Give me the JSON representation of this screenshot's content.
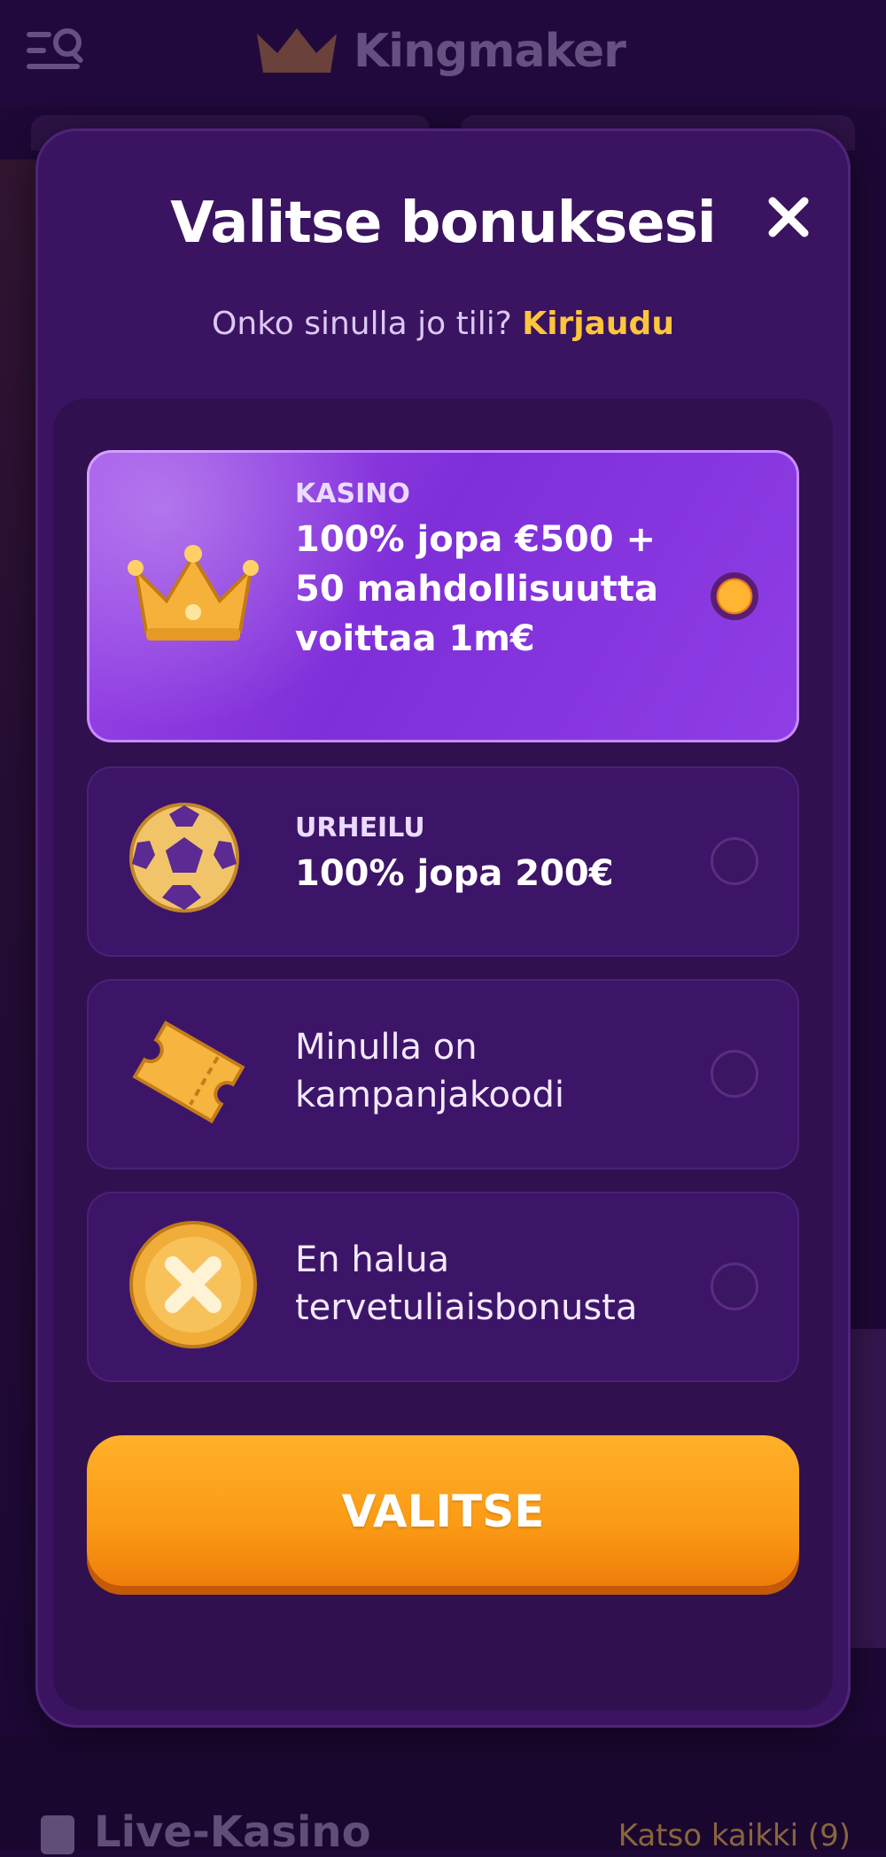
{
  "background": {
    "logo_text": "Kingmaker",
    "section_title": "Live-Kasino",
    "see_all": "Katso kaikki (9)"
  },
  "modal": {
    "title": "Valitse bonuksesi",
    "login_prompt": "Onko sinulla jo tili?",
    "login_link": "Kirjaudu",
    "options": [
      {
        "category": "KASINO",
        "text": "100% jopa €500 + 50 mahdollisuutta voittaa 1m€",
        "icon": "crown-icon",
        "selected": true
      },
      {
        "category": "URHEILU",
        "text": "100% jopa 200€",
        "icon": "football-icon",
        "selected": false
      },
      {
        "category": "",
        "text": "Minulla on kampanjakoodi",
        "icon": "ticket-icon",
        "selected": false
      },
      {
        "category": "",
        "text": "En halua tervetuliaisbonusta",
        "icon": "no-bonus-coin-icon",
        "selected": false
      }
    ],
    "submit_label": "VALITSE"
  },
  "colors": {
    "modal_bg": "#3a1460",
    "selected_option": "#8f3ee6",
    "accent_gold": "#ffc53d",
    "button_orange": "#fb9a15"
  }
}
